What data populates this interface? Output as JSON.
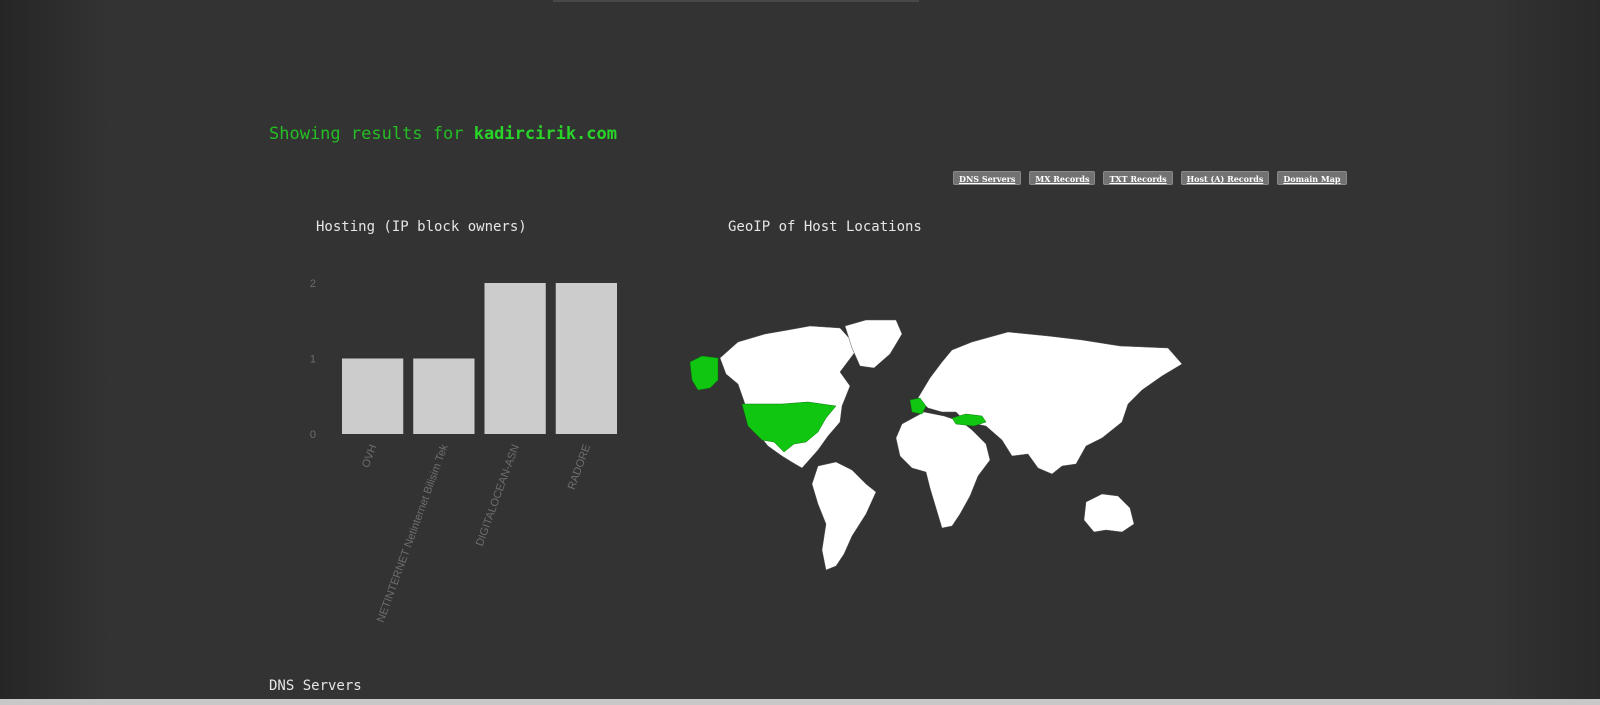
{
  "results": {
    "prefix": "Showing results for ",
    "domain": "kadircirik.com"
  },
  "nav_buttons": [
    {
      "label": "DNS Servers"
    },
    {
      "label": "MX Records"
    },
    {
      "label": "TXT Records"
    },
    {
      "label": "Host (A) Records"
    },
    {
      "label": "Domain Map"
    }
  ],
  "hosting": {
    "title": "Hosting (IP block owners)"
  },
  "geoip": {
    "title": "GeoIP of Host Locations",
    "highlight_color": "#11c611",
    "land_color": "#ffffff",
    "highlighted_regions": [
      "United States",
      "Alaska",
      "France",
      "Turkey"
    ]
  },
  "sections": {
    "dns_servers": "DNS Servers"
  },
  "chart_data": {
    "type": "bar",
    "title": "Hosting (IP block owners)",
    "categories": [
      "OVH",
      "NETINTERNET Netinternet Bilisim Tek",
      "DIGITALOCEAN-ASN",
      "RADORE"
    ],
    "values": [
      1,
      1,
      2,
      2
    ],
    "yticks": [
      0,
      1,
      2
    ],
    "ylim": [
      0,
      2
    ],
    "xlabel": "",
    "ylabel": "",
    "grid": false,
    "bar_color": "#cccccc"
  }
}
